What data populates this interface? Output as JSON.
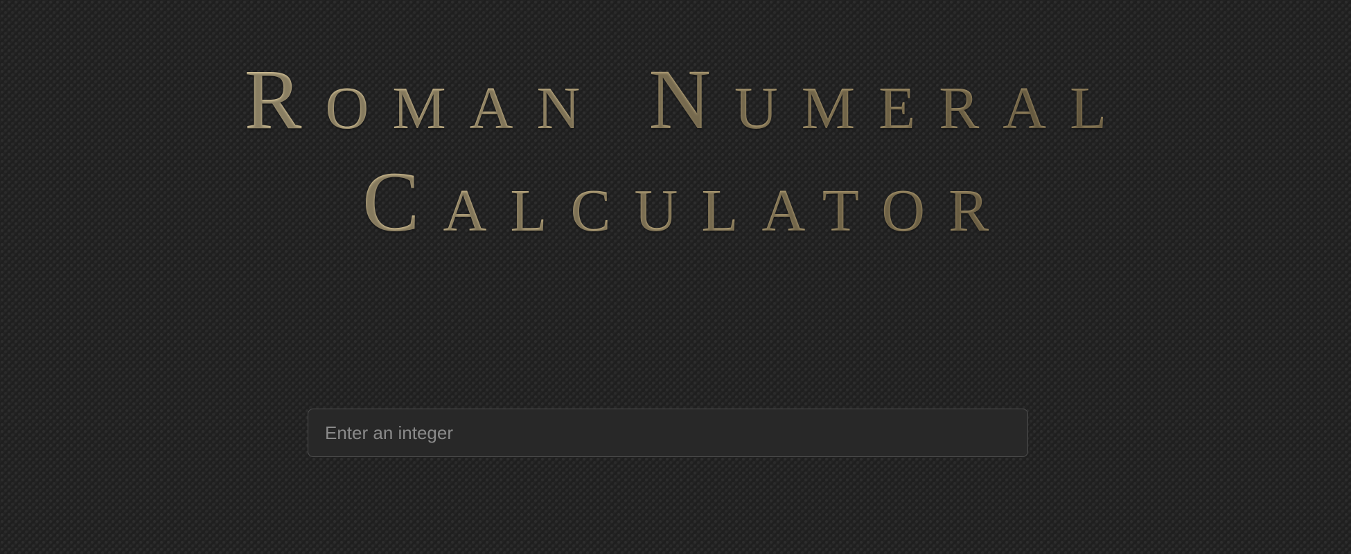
{
  "header": {
    "title_line1": "Roman Numeral",
    "title_line2": "Calculator"
  },
  "converter": {
    "input_value": "",
    "input_placeholder": "Enter an integer"
  }
}
